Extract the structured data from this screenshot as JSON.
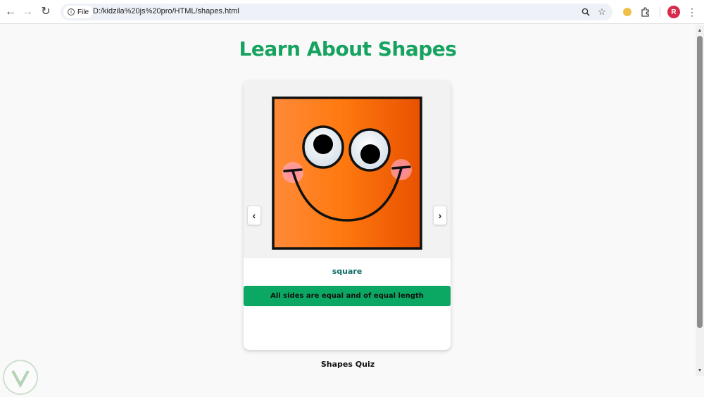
{
  "browser": {
    "site_info_label": "File",
    "url": "D:/kidzila%20js%20pro/HTML/shapes.html",
    "avatar_initial": "R"
  },
  "page": {
    "title": "Learn About Shapes",
    "card": {
      "shape_name": "square",
      "description": "All sides are equal and of equal length",
      "prev_label": "‹",
      "next_label": "›"
    },
    "quiz_label": "Shapes Quiz"
  },
  "colors": {
    "title_green": "#16a35f",
    "description_bar": "#0aa862",
    "shape_name": "#0f6e66",
    "square_orange": "#ff7a1a",
    "avatar": "#d92b4b"
  }
}
